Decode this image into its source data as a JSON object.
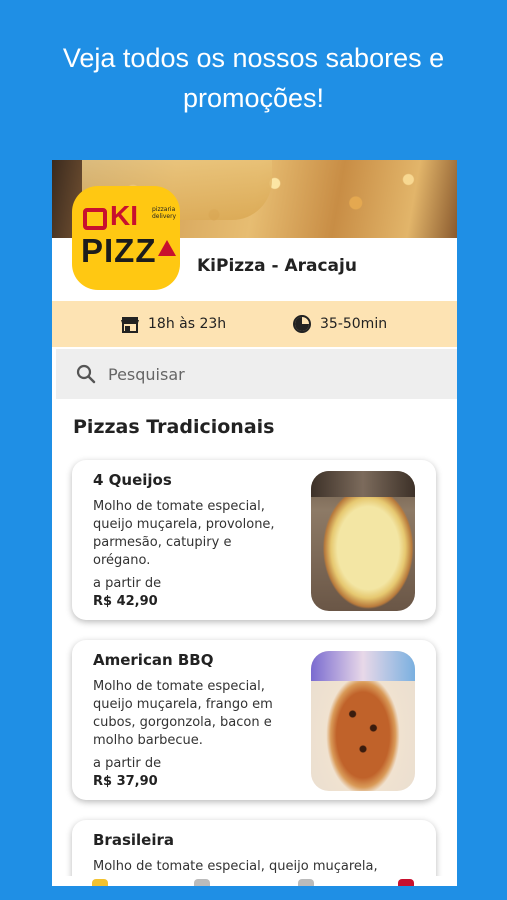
{
  "headline": "Veja todos os nossos sabores e promoções!",
  "store": {
    "logo_top": "KI",
    "logo_bottom": "PIZZ",
    "logo_small": "pizzaria delivery",
    "name": "KiPizza - Aracaju",
    "hours": "18h às 23h",
    "delivery_time": "35-50min"
  },
  "search": {
    "placeholder": "Pesquisar"
  },
  "section_title": "Pizzas Tradicionais",
  "products": [
    {
      "name": "4 Queijos",
      "description": "Molho de tomate especial, queijo muçarela, provolone, parmesão, catupiry e orégano.",
      "price_prefix": "a partir de",
      "price": "R$ 42,90"
    },
    {
      "name": "American BBQ",
      "description": "Molho de tomate especial, queijo muçarela, frango em cubos, gorgonzola, bacon e molho barbecue.",
      "price_prefix": "a partir de",
      "price": "R$ 37,90"
    },
    {
      "name": "Brasileira",
      "description": "Molho de tomate especial, queijo muçarela,"
    }
  ],
  "colors": {
    "background": "#1f8fe5",
    "logo_yellow": "#ffc812",
    "logo_red": "#c8102e",
    "info_bar": "#fde3b3"
  },
  "icons": [
    "store-icon",
    "clock-icon",
    "search-icon"
  ]
}
